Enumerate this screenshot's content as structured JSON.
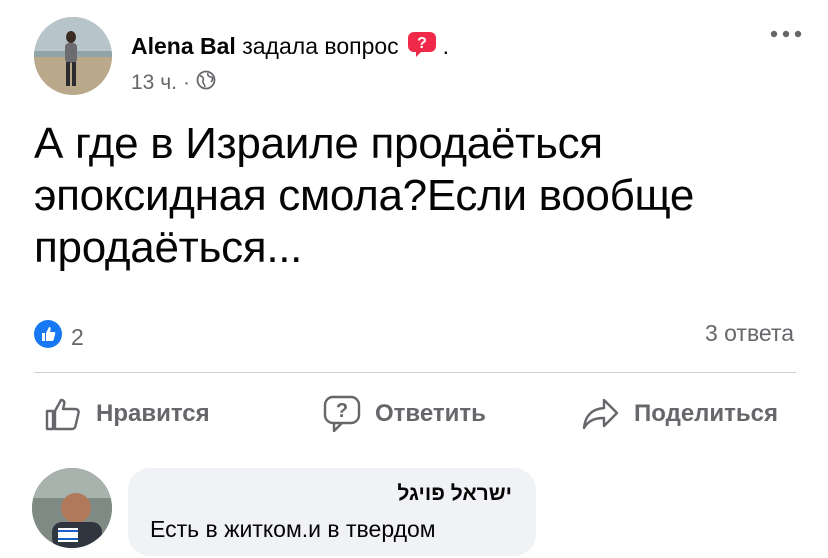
{
  "post": {
    "author_name": "Alena Bal",
    "action_text": "задала вопрос",
    "action_suffix": ".",
    "time": "13 ч.",
    "separator": "·",
    "text": "А где в Израиле продаёться эпоксидная смола?Если вообще продаёться...",
    "reactions_count": "2",
    "answers_count": "3 ответа"
  },
  "actions": {
    "like_label": "Нравится",
    "answer_label": "Ответить",
    "share_label": "Поделиться"
  },
  "comment": {
    "author_name": "ישראל פויגל",
    "text": "Есть в житком.и в твердом"
  },
  "colors": {
    "accent": "#1877f2",
    "badge": "#f02849",
    "muted": "#65676b",
    "bubble": "#f0f2f5"
  },
  "icons": [
    "question-badge-icon",
    "globe-icon",
    "more-icon",
    "like-reaction-icon",
    "thumbs-up-icon",
    "question-icon",
    "share-arrow-icon"
  ]
}
